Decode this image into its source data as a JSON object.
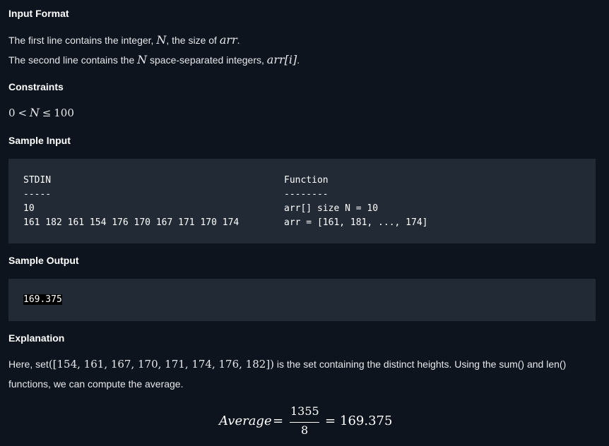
{
  "input_format": {
    "heading": "Input Format",
    "line1_pre": "The first line contains the integer, ",
    "line1_var": "N",
    "line1_mid": ", the size of ",
    "line1_arr": "arr",
    "line1_end": ".",
    "line2_pre": "The second line contains the ",
    "line2_var": "N",
    "line2_mid": " space-separated integers, ",
    "line2_arr": "arr",
    "line2_idx": "[i]",
    "line2_end": "."
  },
  "constraints": {
    "heading": "Constraints",
    "zero": "0",
    "lt": "<",
    "var": "N",
    "le": "≤",
    "max": "100"
  },
  "sample_input": {
    "heading": "Sample Input",
    "stdin_label": "STDIN",
    "stdin_rule": "-----",
    "stdin_line1": "10",
    "stdin_line2": "161 182 161 154 176 170 167 171 170 174",
    "func_label": "Function",
    "func_rule": "--------",
    "func_line1": "arr[] size N = 10",
    "func_line2": "arr = [161, 181, ..., 174]"
  },
  "sample_output": {
    "heading": "Sample Output",
    "value": "169.375"
  },
  "explanation": {
    "heading": "Explanation",
    "line1_pre": "Here, set",
    "line1_set": "([154, 161, 167, 170, 171, 174, 176, 182])",
    "line1_post": " is the set containing the distinct heights. Using the sum() and len()",
    "line2": "functions, we can compute the average."
  },
  "formula": {
    "lhs": "Average",
    "eq1": "=",
    "numerator": "1355",
    "denominator": "8",
    "eq2": "=",
    "result": "169.375"
  }
}
